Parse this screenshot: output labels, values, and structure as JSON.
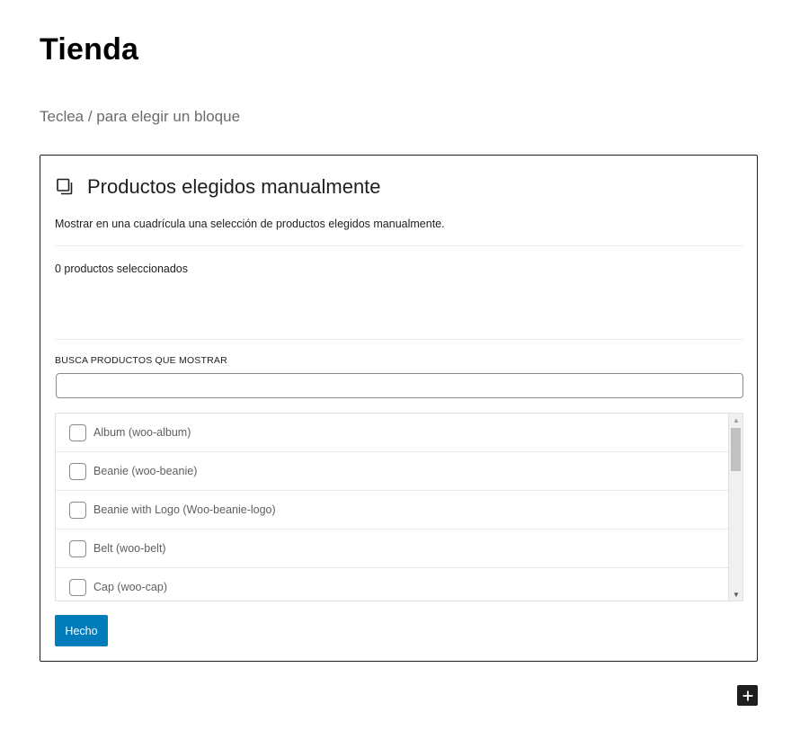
{
  "page": {
    "title": "Tienda",
    "block_prompt": "Teclea / para elegir un bloque"
  },
  "block": {
    "icon": "product-stack-icon",
    "title": "Productos elegidos manualmente",
    "description": "Mostrar en una cuadrícula una selección de productos elegidos manualmente.",
    "selected_count": "0 productos seleccionados",
    "search": {
      "label": "BUSCA PRODUCTOS QUE MOSTRAR",
      "value": "",
      "placeholder": ""
    },
    "products": [
      {
        "label": "Album (woo-album)",
        "checked": false
      },
      {
        "label": "Beanie (woo-beanie)",
        "checked": false
      },
      {
        "label": "Beanie with Logo (Woo-beanie-logo)",
        "checked": false
      },
      {
        "label": "Belt (woo-belt)",
        "checked": false
      },
      {
        "label": "Cap (woo-cap)",
        "checked": false
      }
    ],
    "done_label": "Hecho"
  },
  "add_block": {
    "icon": "plus-icon"
  },
  "colors": {
    "primary_button": "#007cba",
    "add_button": "#1e1e1e",
    "block_border": "#1e1e1e"
  }
}
